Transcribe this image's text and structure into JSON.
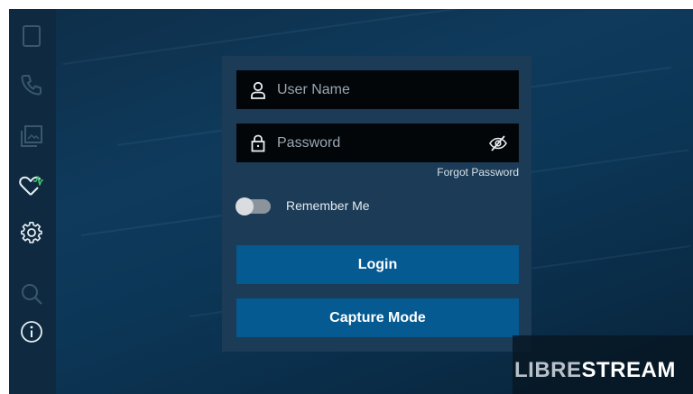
{
  "sidebar": {
    "items": [
      {
        "icon": "tablet-icon",
        "state": "disabled"
      },
      {
        "icon": "phone-icon",
        "state": "disabled"
      },
      {
        "icon": "gallery-icon",
        "state": "disabled"
      },
      {
        "icon": "heart-pulse-icon",
        "state": "enabled"
      },
      {
        "icon": "gear-icon",
        "state": "enabled"
      },
      {
        "icon": "search-icon",
        "state": "disabled"
      },
      {
        "icon": "info-icon",
        "state": "enabled"
      }
    ]
  },
  "login": {
    "username_placeholder": "User Name",
    "username_value": "",
    "password_placeholder": "Password",
    "password_value": "",
    "forgot_password": "Forgot Password",
    "remember_me": "Remember Me",
    "remember_me_on": false,
    "login_button": "Login",
    "capture_button": "Capture Mode"
  },
  "brand": {
    "part1": "LIBRE",
    "part2": "STREAM"
  },
  "colors": {
    "accent": "#065a92",
    "panel": "#1b3b56",
    "field": "#020609",
    "heartbeat": "#3ec46d"
  }
}
